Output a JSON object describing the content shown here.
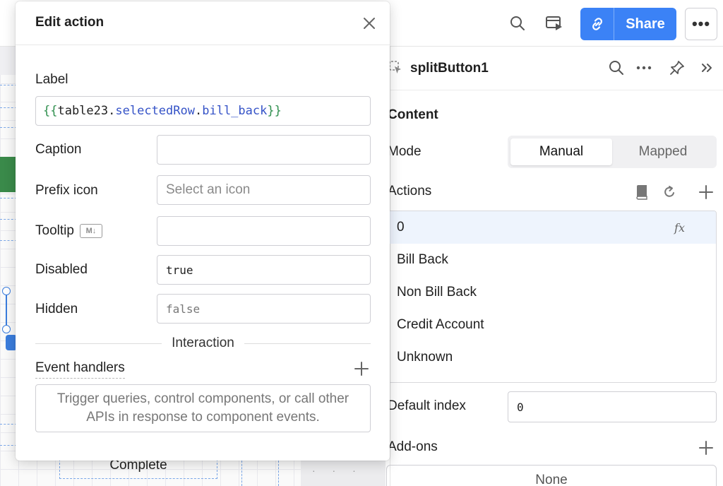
{
  "toolbar": {
    "share_label": "Share",
    "more_label": "•••"
  },
  "inspector": {
    "component_name": "splitButton1",
    "content_title": "Content",
    "mode_label": "Mode",
    "mode_options": [
      "Manual",
      "Mapped"
    ],
    "mode_selected": "Manual",
    "actions_label": "Actions",
    "actions": [
      {
        "label": "0",
        "has_fx": true
      },
      {
        "label": "Bill Back"
      },
      {
        "label": "Non Bill Back"
      },
      {
        "label": "Credit Account"
      },
      {
        "label": "Unknown"
      }
    ],
    "fx_label": "fx",
    "default_index_label": "Default index",
    "default_index_value": "0",
    "addons_label": "Add-ons",
    "addons_value": "None"
  },
  "canvas": {
    "complete_label": "Complete"
  },
  "modal": {
    "title": "Edit action",
    "label_field_label": "Label",
    "label_tokens": {
      "open": "{{",
      "object": "table23",
      "dot1": ".",
      "prop1": "selectedRow",
      "dot2": ".",
      "prop2": "bill_back",
      "close": "}}"
    },
    "caption_label": "Caption",
    "caption_value": "",
    "prefix_icon_label": "Prefix icon",
    "prefix_icon_placeholder": "Select an icon",
    "tooltip_label": "Tooltip",
    "tooltip_badge": "M↓",
    "tooltip_value": "",
    "disabled_label": "Disabled",
    "disabled_value": "true",
    "hidden_label": "Hidden",
    "hidden_placeholder": "false",
    "interaction_label": "Interaction",
    "event_handlers_label": "Event handlers",
    "event_handlers_empty": "Trigger queries, control components, or call other APIs in response to component events."
  },
  "colors": {
    "accent": "#3b82f6",
    "selection": "#3b7ddd",
    "token_brace": "#2f8f4e",
    "token_prop": "#3553c7",
    "canvas_green": "#3a8a4a"
  }
}
